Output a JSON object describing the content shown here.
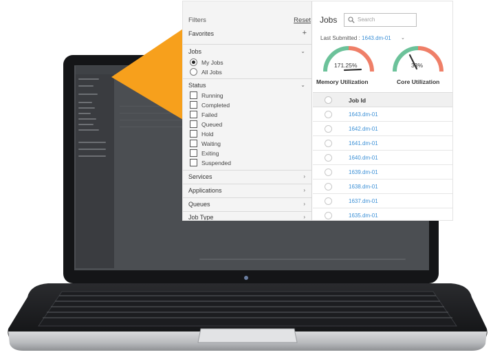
{
  "filters": {
    "title": "Filters",
    "reset_label": "Reset",
    "favorites": {
      "label": "Favorites",
      "icon": "plus-icon"
    },
    "jobs": {
      "label": "Jobs",
      "options": [
        {
          "label": "My Jobs",
          "selected": true
        },
        {
          "label": "All Jobs",
          "selected": false
        }
      ]
    },
    "status": {
      "label": "Status",
      "options": [
        "Running",
        "Completed",
        "Failed",
        "Queued",
        "Hold",
        "Waiting",
        "Exiting",
        "Suspended"
      ]
    },
    "collapsed_sections": [
      "Services",
      "Applications",
      "Queues",
      "Job Type"
    ]
  },
  "jobs_panel": {
    "title": "Jobs",
    "search_placeholder": "Search",
    "last_submitted_label": "Last Submitted :",
    "last_submitted_value": "1643.dm-01",
    "gauges": [
      {
        "label": "Memory Utilization",
        "value_text": "171.25%",
        "value": 1.7125
      },
      {
        "label": "Core Utilization",
        "value_text": "33%",
        "value": 0.33
      }
    ],
    "table": {
      "column_header": "Job Id",
      "rows": [
        "1643.dm-01",
        "1642.dm-01",
        "1641.dm-01",
        "1640.dm-01",
        "1639.dm-01",
        "1638.dm-01",
        "1637.dm-01",
        "1635.dm-01"
      ]
    }
  },
  "colors": {
    "accent_orange": "#F7A01C",
    "link_blue": "#3A8FD6",
    "gauge_green": "#6CC29A",
    "gauge_red": "#EF7F68"
  }
}
